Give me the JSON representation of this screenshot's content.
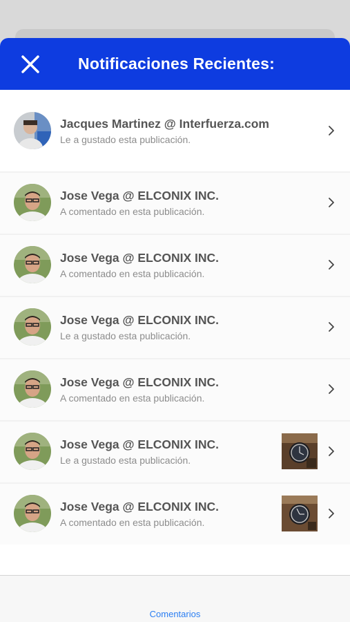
{
  "header": {
    "title": "Notificaciones Recientes:"
  },
  "notifications": [
    {
      "name": "Jacques Martinez @ Interfuerza.com",
      "action": "Le a gustado esta publicación.",
      "has_thumbnail": false
    },
    {
      "name": "Jose Vega @ ELCONIX INC.",
      "action": "A comentado en esta publicación.",
      "has_thumbnail": false
    },
    {
      "name": "Jose Vega @ ELCONIX INC.",
      "action": "A comentado en esta publicación.",
      "has_thumbnail": false
    },
    {
      "name": "Jose Vega @ ELCONIX INC.",
      "action": "Le a gustado esta publicación.",
      "has_thumbnail": false
    },
    {
      "name": "Jose Vega @ ELCONIX INC.",
      "action": "A comentado en esta publicación.",
      "has_thumbnail": false
    },
    {
      "name": "Jose Vega @ ELCONIX INC.",
      "action": "Le a gustado esta publicación.",
      "has_thumbnail": true
    },
    {
      "name": "Jose Vega @ ELCONIX INC.",
      "action": "A comentado en esta publicación.",
      "has_thumbnail": true
    }
  ],
  "tabbar": {
    "label": "Comentarios"
  },
  "colors": {
    "header_bg": "#0e3ce0",
    "tab_accent": "#2b7ef2"
  }
}
